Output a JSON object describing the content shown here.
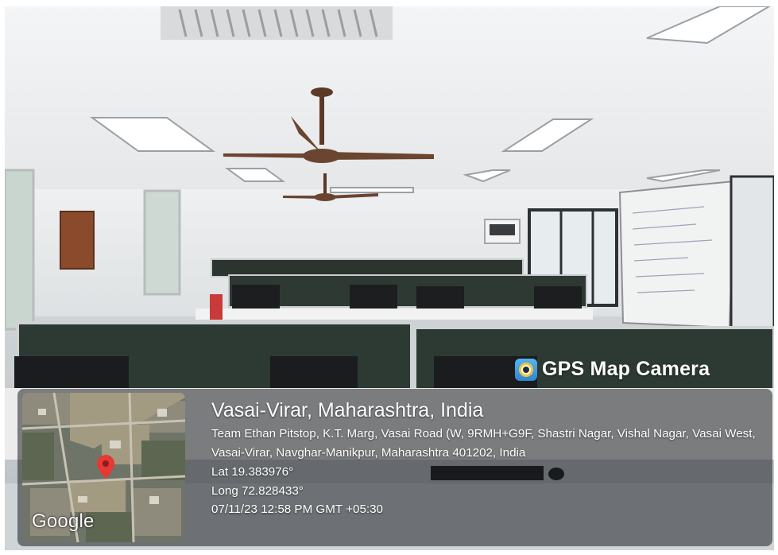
{
  "watermark": {
    "app_name": "GPS Map Camera",
    "logo_icon": "gps-map-camera-logo-icon"
  },
  "map": {
    "provider_label": "Google",
    "pin_color": "#e53935"
  },
  "location": {
    "title": "Vasai-Virar, Maharashtra, India",
    "address": "Team Ethan Pitstop, K.T. Marg, Vasai Road (W, 9RMH+G9F, Shastri Nagar, Vishal Nagar, Vasai West, Vasai-Virar, Navghar-Manikpur, Maharashtra 401202, India",
    "latitude": "Lat 19.383976°",
    "longitude": "Long 72.828433°",
    "timestamp": "07/11/23 12:58 PM GMT +05:30"
  }
}
